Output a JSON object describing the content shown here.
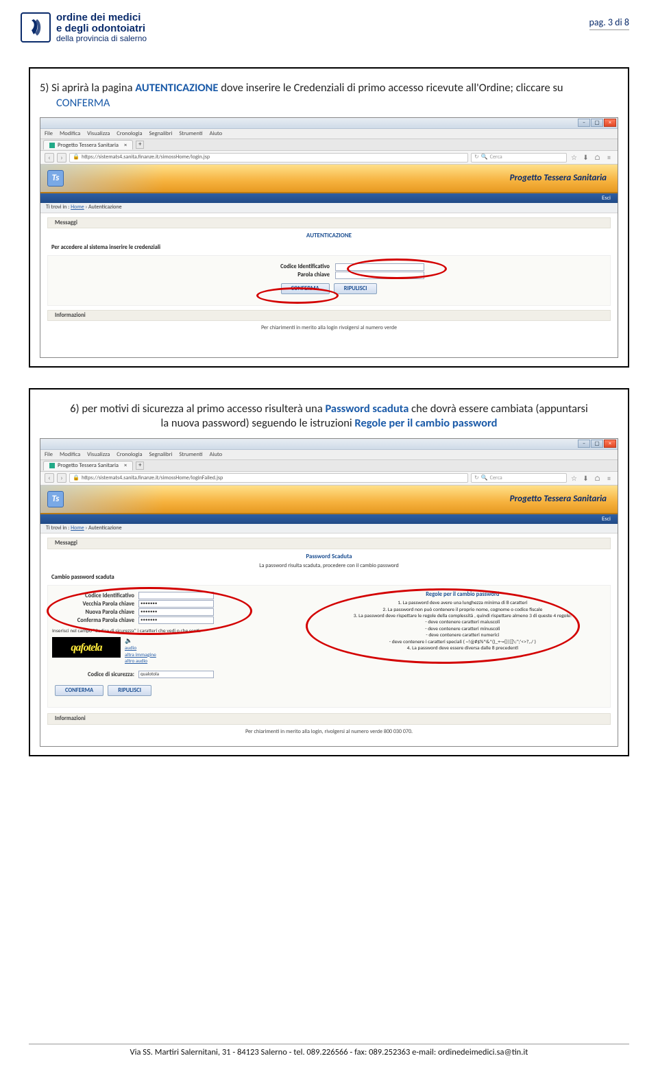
{
  "header": {
    "logo_line1": "ordine dei medici",
    "logo_line2": "e degli odontoiatri",
    "logo_line3": "della provincia di salerno",
    "page_num": "pag. 3 di 8"
  },
  "step5": {
    "num": "5)",
    "t1": "Si aprirà la pagina ",
    "kw1": "AUTENTICAZIONE",
    "t2": " dove inserire le Credenziali di primo accesso ricevute all'Ordine; cliccare su ",
    "kw2": "CONFERMA"
  },
  "step6": {
    "num": "6)",
    "t1": "per motivi di sicurezza al primo accesso risulterà una ",
    "kw1": "Password scaduta",
    "t2": " che dovrà essere cambiata (appuntarsi la nuova password) seguendo le istruzioni ",
    "kw2": "Regole per il cambio password"
  },
  "browser": {
    "menu": [
      "File",
      "Modifica",
      "Visualizza",
      "Cronologia",
      "Segnalibri",
      "Strumenti",
      "Aiuto"
    ],
    "tab_title": "Progetto Tessera Sanitaria",
    "url1": "https://sistemats4.sanita.finanze.it/simossHome/login.jsp",
    "url2": "https://sistemats4.sanita.finanze.it/simossHome/loginFailed.jsp",
    "search_ph": "C",
    "search_lbl": "Cerca",
    "banner_title": "Progetto Tessera Sanitaria",
    "esci": "Esci",
    "crumb_pre": "Ti trovi in : ",
    "crumb_home": "Home",
    "crumb_sep": " › Autenticazione"
  },
  "shot1": {
    "messaggi": "Messaggi",
    "sect": "AUTENTICAZIONE",
    "prompt": "Per accedere al sistema inserire le credenziali",
    "lbl_id": "Codice Identificativo",
    "lbl_pw": "Parola chiave",
    "btn_conf": "CONFERMA",
    "btn_clear": "RIPULISCI",
    "info": "Informazioni",
    "foot": "Per chiarimenti in merito alla login rivolgersi al numero verde"
  },
  "shot2": {
    "messaggi": "Messaggi",
    "sect": "Password Scaduta",
    "subline": "La password risulta scaduta, procedere con il cambio password",
    "block": "Cambio password scaduta",
    "lbl_id": "Codice Identificativo",
    "lbl_old": "Vecchia Parola chiave",
    "lbl_new": "Nuova Parola chiave",
    "lbl_conf": "Conferma Parola chiave",
    "dots": "•••••••",
    "hint": "Inserisci nel campo \"Codice di sicurezza\" i caratteri che vedi o che senti:",
    "captcha_text": "qafotela",
    "cap_link1": "audio",
    "cap_link2": "altra immagine",
    "cap_link3": "altro audio",
    "lbl_sec": "Codice di sicurezza:",
    "sec_val": "qualotola",
    "btn_conf": "CONFERMA",
    "btn_clear": "RIPULISCI",
    "rules_title": "Regole per il cambio password",
    "r1": "1. La password deve avere una lunghezza minima di 8 caratteri",
    "r2": "2. La password non può contenere il proprio nome, cognome o codice fiscale",
    "r3": "3. La password deve rispettare le regole della complessità , quindi rispettare almeno 3 di queste 4 regole:",
    "r3a": "- deve contenere caratteri maiuscoli",
    "r3b": "- deve contenere caratteri minuscoli",
    "r3c": "- deve contenere caratteri numerici",
    "r3d": "- deve contenere i caratteri speciali ( ~!@#$%^&*()_+-={}|[]\\:\";'<>?,./ )",
    "r4": "4. La password deve essere diversa dalle 8 precedenti",
    "info": "Informazioni",
    "foot": "Per chiarimenti in merito alla login, rivolgersi al numero verde 800 030 070."
  },
  "footer": "Via SS. Martiri Salernitani, 31 - 84123 Salerno -  tel. 089.226566   - fax: 089.252363 e-mail: ordinedeimedici.sa@tin.it"
}
